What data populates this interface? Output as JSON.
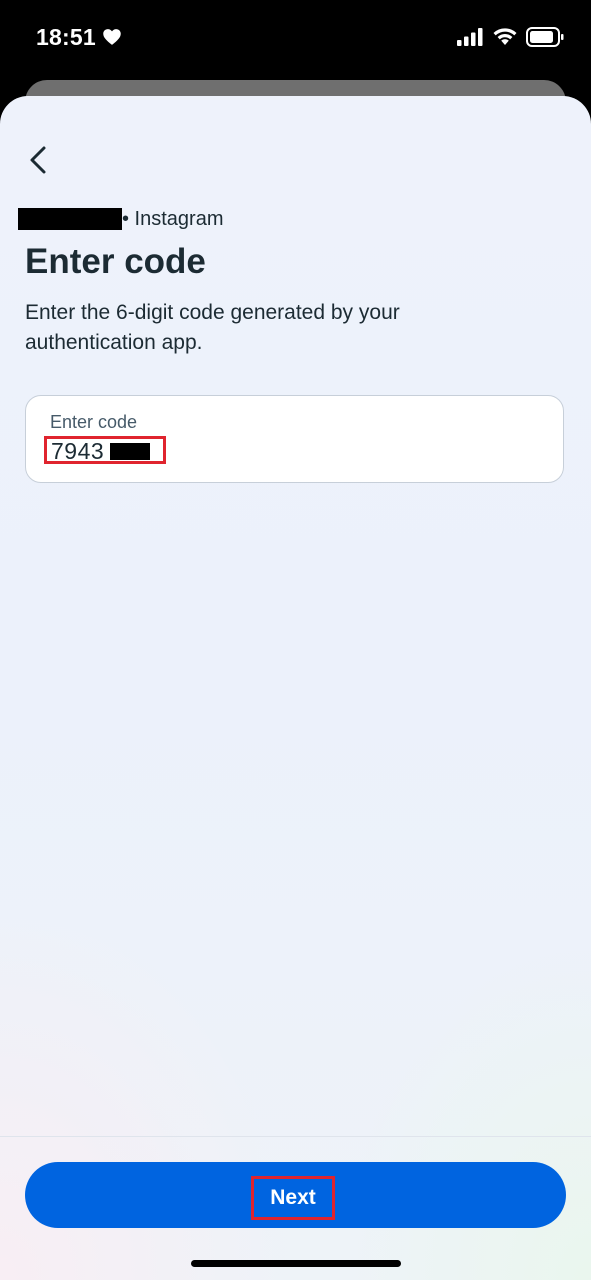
{
  "status_bar": {
    "time": "18:51",
    "icons": [
      "heart-icon",
      "signal-icon",
      "wifi-icon",
      "battery-icon"
    ]
  },
  "header": {
    "back_icon": "chevron-left-icon",
    "account_platform": "• Instagram",
    "title": "Enter code",
    "description": "Enter the 6-digit code generated by your authentication app."
  },
  "code_field": {
    "label": "Enter code",
    "value": "7943"
  },
  "footer": {
    "next_label": "Next"
  },
  "colors": {
    "primary_button": "#0064e0",
    "text_primary": "#1c2b33",
    "highlight_box": "#e0242e"
  }
}
